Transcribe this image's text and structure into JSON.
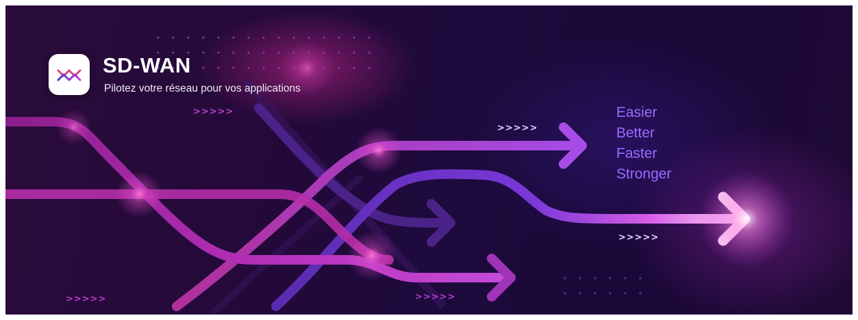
{
  "brand": {
    "title": "SD-WAN",
    "subtitle": "Pilotez votre réseau pour vos applications",
    "logo_icon": "double-chevron-wave-icon"
  },
  "tagline": [
    "Easier",
    "Better",
    "Faster",
    "Stronger"
  ],
  "decor": {
    "chevrons": ">>>>>",
    "colors": {
      "background": "#1d0a3c",
      "magenta": "#c23cd6",
      "violet": "#6a36c8",
      "pink": "#ff7fe0",
      "tagline": "#9b6cff"
    }
  }
}
